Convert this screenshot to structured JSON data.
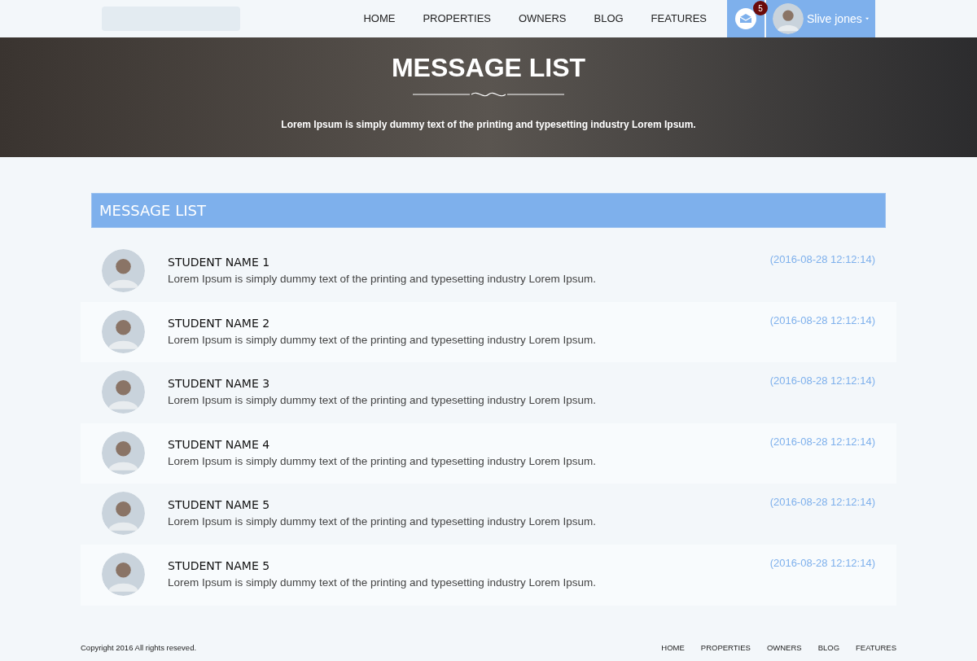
{
  "nav": {
    "links": [
      "HOME",
      "PROPERTIES",
      "OWNERS",
      "BLOG",
      "FEATURES"
    ],
    "messages_badge": "5",
    "user_name": "Slive jones"
  },
  "hero": {
    "title": "MESSAGE LIST",
    "subtitle": "Lorem Ipsum is simply dummy text of the printing and typesetting industry Lorem Ipsum."
  },
  "panel": {
    "title": "MESSAGE LIST"
  },
  "messages": [
    {
      "name": "STUDENT NAME 1",
      "text": "Lorem Ipsum is simply dummy text of the printing and typesetting industry Lorem Ipsum.",
      "time": "(2016-08-28 12:12:14)"
    },
    {
      "name": "STUDENT NAME 2",
      "text": "Lorem Ipsum is simply dummy text of the printing and typesetting industry Lorem Ipsum.",
      "time": "(2016-08-28 12:12:14)"
    },
    {
      "name": "STUDENT NAME 3",
      "text": "Lorem Ipsum is simply dummy text of the printing and typesetting industry Lorem Ipsum.",
      "time": "(2016-08-28 12:12:14)"
    },
    {
      "name": "STUDENT NAME 4",
      "text": "Lorem Ipsum is simply dummy text of the printing and typesetting industry Lorem Ipsum.",
      "time": "(2016-08-28 12:12:14)"
    },
    {
      "name": "STUDENT NAME 5",
      "text": "Lorem Ipsum is simply dummy text of the printing and typesetting industry Lorem Ipsum.",
      "time": "(2016-08-28 12:12:14)"
    },
    {
      "name": "STUDENT NAME 5",
      "text": "Lorem Ipsum is simply dummy text of the printing and typesetting industry Lorem Ipsum.",
      "time": "(2016-08-28 12:12:14)"
    }
  ],
  "footer": {
    "copyright": "Copyright 2016 All rights reseved.",
    "links": [
      "HOME",
      "PROPERTIES",
      "OWNERS",
      "BLOG",
      "FEATURES"
    ]
  }
}
